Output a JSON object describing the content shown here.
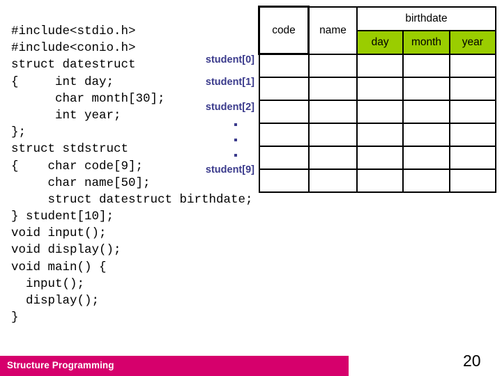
{
  "slide": {
    "number": "20",
    "footer_label": "Structure Programming",
    "footer_color": "#d6006c",
    "accent_green": "#9acd00",
    "label_blue": "#3b3b8c"
  },
  "code": {
    "language": "c",
    "lines": [
      "#include<stdio.h>",
      "#include<conio.h>",
      "struct datestruct",
      "{     int day;",
      "      char month[30];",
      "      int year;",
      "};",
      "struct stdstruct",
      "{    char code[9];",
      "     char name[50];",
      "     struct datestruct birthdate;",
      "} student[10];",
      "void input();",
      "void display();",
      "void main() {",
      "  input();",
      "  display();",
      "}"
    ]
  },
  "array_labels": {
    "items": [
      {
        "id": "student-0",
        "text": "student[0]"
      },
      {
        "id": "student-1",
        "text": "student[1]"
      },
      {
        "id": "student-2",
        "text": "student[2]"
      },
      {
        "id": "student-9",
        "text": "student[9]"
      }
    ],
    "ellipsis_dots": 3
  },
  "table": {
    "header_top": [
      {
        "label": "code",
        "rowspan": 2,
        "colspan": 1,
        "green": false
      },
      {
        "label": "name",
        "rowspan": 2,
        "colspan": 1,
        "green": false
      },
      {
        "label": "birthdate",
        "rowspan": 1,
        "colspan": 3,
        "green": false
      }
    ],
    "header_sub": [
      {
        "label": "day",
        "green": true
      },
      {
        "label": "month",
        "green": true
      },
      {
        "label": "year",
        "green": true
      }
    ],
    "body_row_count": 6,
    "column_count": 5,
    "cell_value": ""
  }
}
